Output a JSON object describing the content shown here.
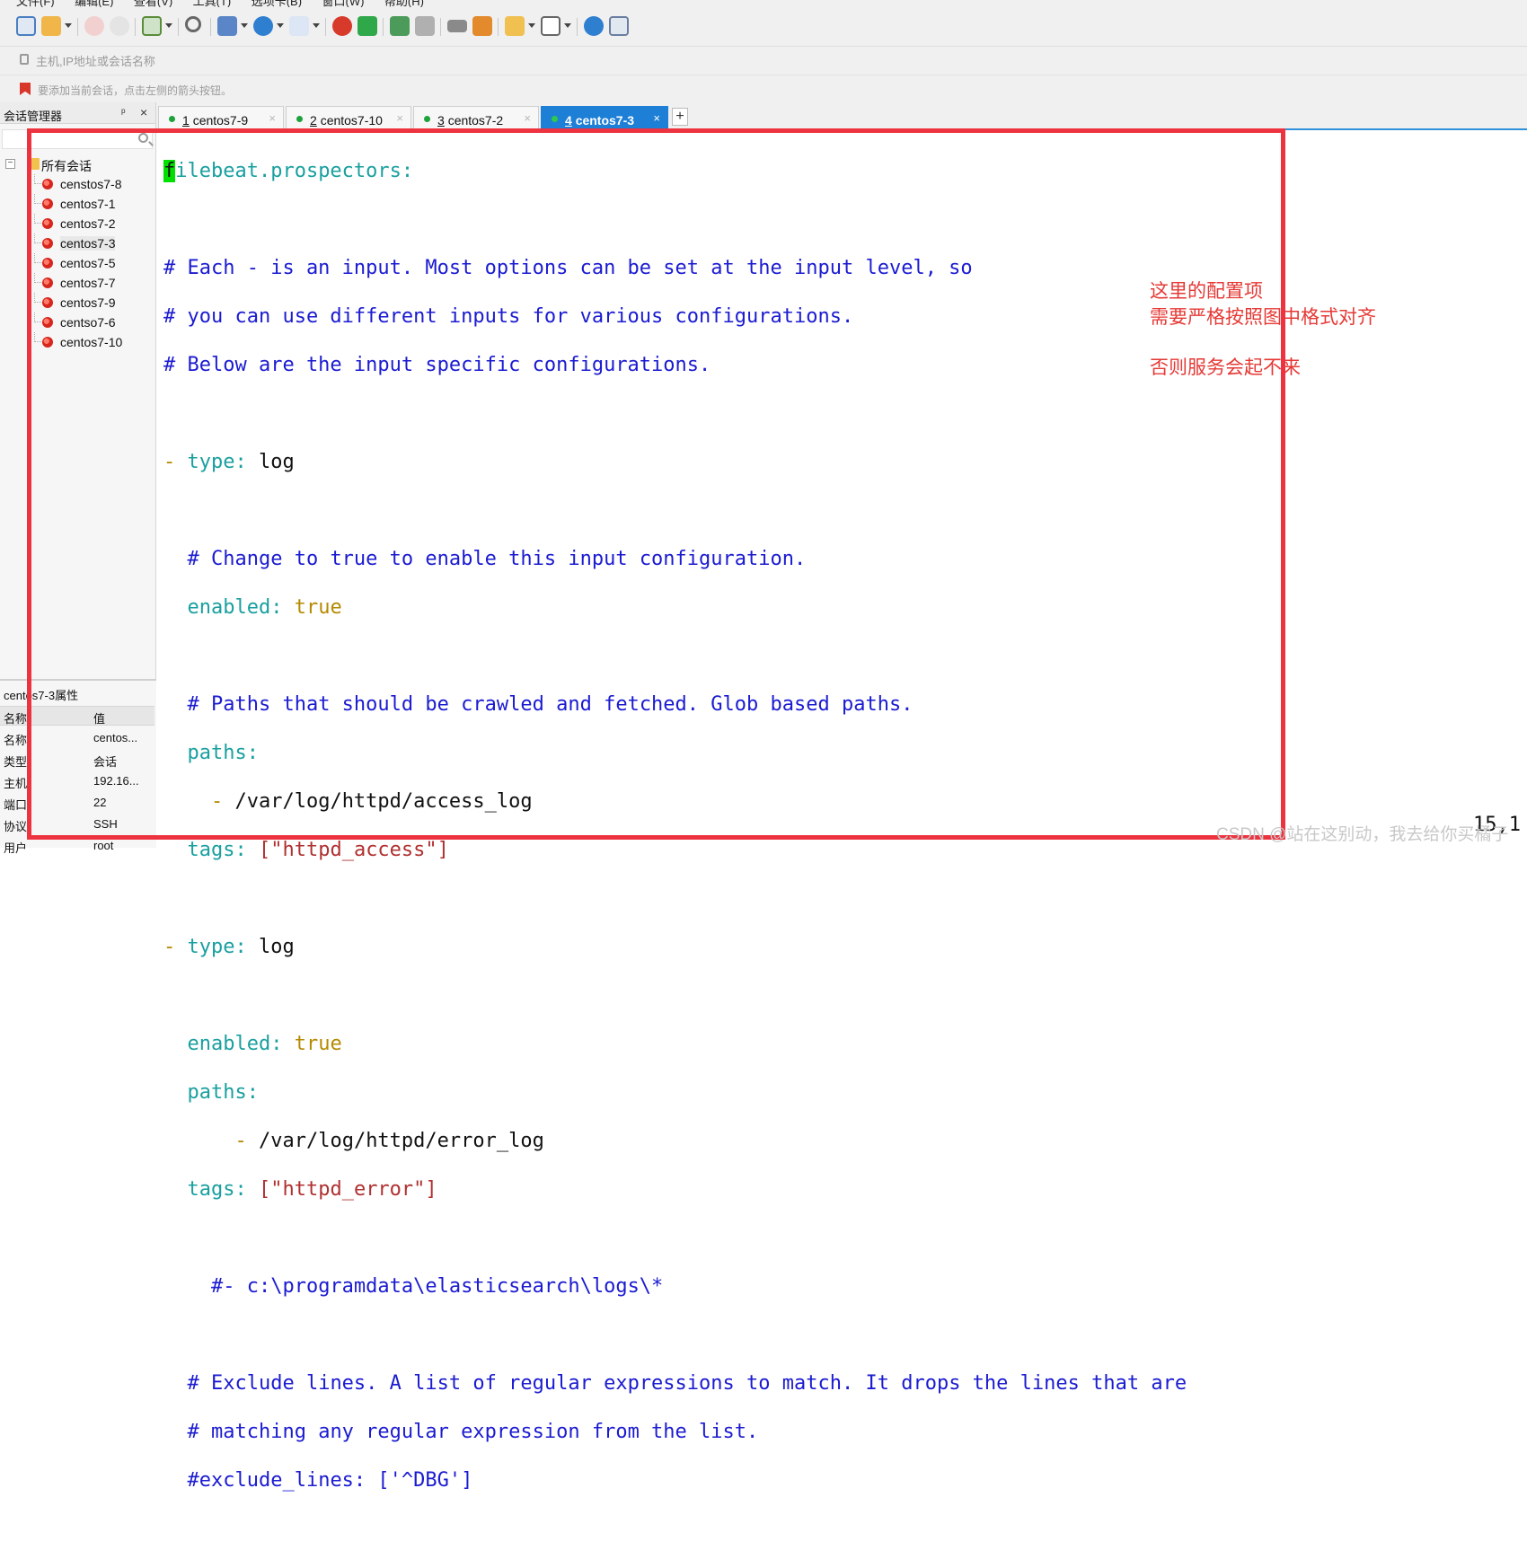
{
  "menubar": {
    "items": [
      "文件(F)",
      "编辑(E)",
      "查看(V)",
      "工具(T)",
      "选项卡(B)",
      "窗口(W)",
      "帮助(H)"
    ]
  },
  "toolbar": {
    "icons": [
      "new-session-icon",
      "open-folder-icon",
      "connect-icon",
      "disconnect-icon",
      "properties-icon",
      "find-icon",
      "copy-icon",
      "globe-icon",
      "font-icon",
      "xshell-icon",
      "xftp-icon",
      "fullscreen-icon",
      "lock-icon",
      "keyboard-icon",
      "highlight-icon",
      "compose-icon",
      "layout-icon",
      "help-icon",
      "chat-icon"
    ]
  },
  "address": {
    "placeholder": "主机,IP地址或会话名称"
  },
  "hint": {
    "text": "要添加当前会话，点击左侧的箭头按钮。"
  },
  "sidebar": {
    "title": "会话管理器",
    "pin": "ᵖ",
    "close": "×",
    "root_label": "所有会话",
    "sessions": [
      "censtos7-8",
      "centos7-1",
      "centos7-2",
      "centos7-3",
      "centos7-5",
      "centos7-7",
      "centos7-9",
      "centso7-6",
      "centos7-10"
    ],
    "active_session": "centos7-3"
  },
  "properties": {
    "title": "centos7-3属性",
    "header_name": "名称",
    "header_value": "值",
    "rows": [
      {
        "name": "名称",
        "value": "centos..."
      },
      {
        "name": "类型",
        "value": "会话"
      },
      {
        "name": "主机",
        "value": "192.16..."
      },
      {
        "name": "端口",
        "value": "22"
      },
      {
        "name": "协议",
        "value": "SSH"
      },
      {
        "name": "用户名",
        "value": "root"
      }
    ]
  },
  "tabs": [
    {
      "num": "1",
      "label": "centos7-9"
    },
    {
      "num": "2",
      "label": "centos7-10"
    },
    {
      "num": "3",
      "label": "centos7-2"
    },
    {
      "num": "4",
      "label": "centos7-3"
    }
  ],
  "tab_add": "+",
  "terminal": {
    "cursor_char": "f",
    "lines": {
      "l1": "ilebeat.prospectors:",
      "l2": "# Each - is an input. Most options can be set at the input level, so",
      "l3": "# you can use different inputs for various configurations.",
      "l4": "# Below are the input specific configurations.",
      "dash1": "-",
      "type_key": "type:",
      "type_val": "log",
      "c_change": "# Change to true to enable this input configuration.",
      "enabled_key": "enabled:",
      "enabled_val": "true",
      "c_paths": "# Paths that should be crawled and fetched. Glob based paths.",
      "paths_key": "paths:",
      "path_dash": "-",
      "path1": "/var/log/httpd/access_log",
      "tags_key": "tags:",
      "tags1_val": "[\"httpd_access\"]",
      "path2": "/var/log/httpd/error_log",
      "tags2_val": "[\"httpd_error\"]",
      "win_comment": "#- c:\\programdata\\elasticsearch\\logs\\*",
      "c_exclude1": "# Exclude lines. A list of regular expressions to match. It drops the lines that are",
      "c_exclude2": "# matching any regular expression from the list.",
      "c_exclude3": "#exclude_lines: ['^DBG']"
    },
    "cursor_position": "15,1"
  },
  "annotation": {
    "line1": "这里的配置项",
    "line2": "需要严格按照图中格式对齐",
    "line3": "否则服务会起不来"
  },
  "watermark": "CSDN @站在这别动，我去给你买橘子",
  "colors": {
    "highlight_box": "#ee3340",
    "active_tab": "#1e7fd6",
    "annotation": "#e53935"
  }
}
